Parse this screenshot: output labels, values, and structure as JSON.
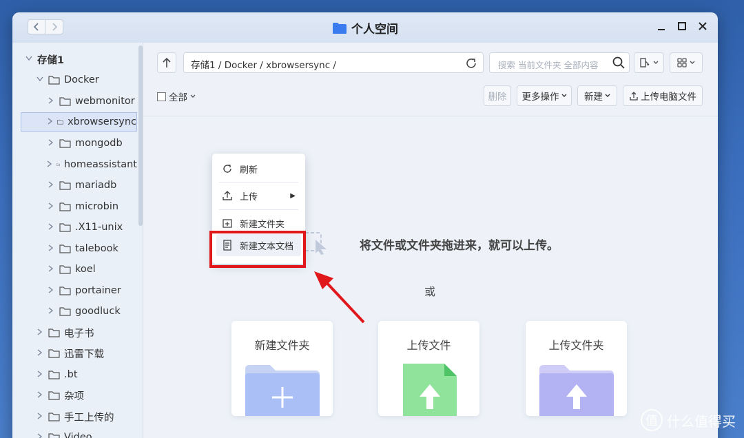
{
  "window": {
    "title": "个人空间"
  },
  "sidebar": {
    "items": [
      {
        "label": "存储1",
        "level": 0,
        "expanded": true
      },
      {
        "label": "Docker",
        "level": 1,
        "expanded": true
      },
      {
        "label": "webmonitor",
        "level": 2
      },
      {
        "label": "xbrowsersync",
        "level": 2,
        "selected": true
      },
      {
        "label": "mongodb",
        "level": 2
      },
      {
        "label": "homeassistant",
        "level": 2
      },
      {
        "label": "mariadb",
        "level": 2
      },
      {
        "label": "microbin",
        "level": 2
      },
      {
        "label": ".X11-unix",
        "level": 2
      },
      {
        "label": "talebook",
        "level": 2
      },
      {
        "label": "koel",
        "level": 2
      },
      {
        "label": "portainer",
        "level": 2
      },
      {
        "label": "goodluck",
        "level": 2
      },
      {
        "label": "电子书",
        "level": 1
      },
      {
        "label": "迅雷下载",
        "level": 1
      },
      {
        "label": ".bt",
        "level": 1
      },
      {
        "label": "杂项",
        "level": 1
      },
      {
        "label": "手工上传的",
        "level": 1
      },
      {
        "label": "Video",
        "level": 1
      }
    ]
  },
  "toolbar": {
    "path": "存储1 / Docker / xbrowsersync /",
    "search_placeholder": "搜索 当前文件夹 全部内容",
    "select_all": "全部",
    "delete": "删除",
    "more_actions": "更多操作",
    "new": "新建",
    "upload_pc": "上传电脑文件"
  },
  "empty_state": {
    "drop_text": "将文件或文件夹拖进来，就可以上传。",
    "or_text": "或",
    "cards": [
      {
        "label": "新建文件夹",
        "icon": "folder-plus-icon",
        "color": "#a9bff5"
      },
      {
        "label": "上传文件",
        "icon": "file-upload-icon",
        "color": "#8fe39a"
      },
      {
        "label": "上传文件夹",
        "icon": "folder-upload-icon",
        "color": "#b3b2f3"
      }
    ]
  },
  "context_menu": {
    "refresh": "刷新",
    "upload": "上传",
    "new_folder": "新建文件夹",
    "new_text_doc": "新建文本文档"
  },
  "watermark": {
    "text": "什么值得买",
    "mark": "值"
  },
  "colors": {
    "highlight": "#e0171b",
    "accent": "#3a7bf0"
  }
}
